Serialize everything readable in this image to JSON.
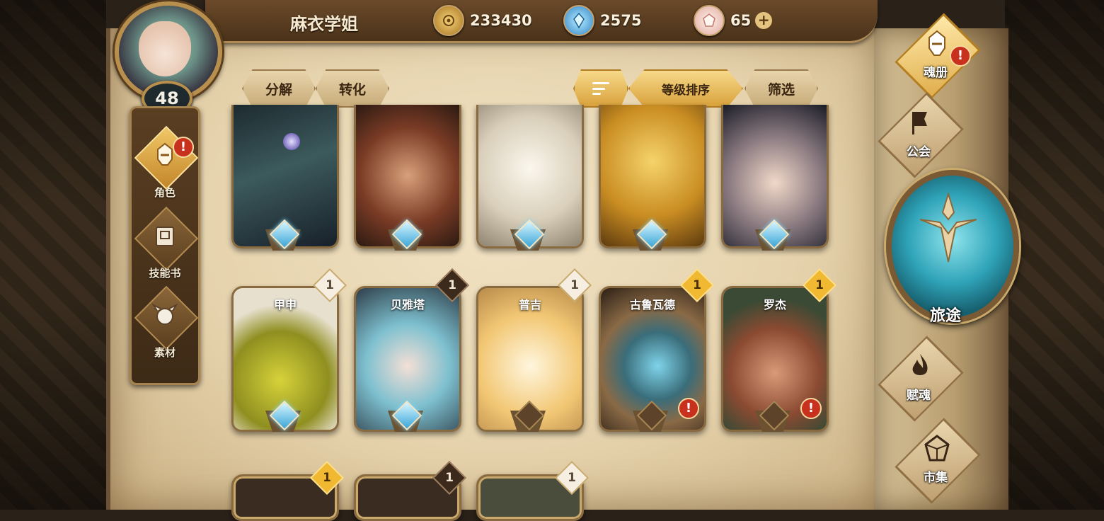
{
  "player": {
    "name": "麻衣学姐",
    "level": "48"
  },
  "currencies": [
    {
      "icon": "gold-coin-icon",
      "value": "233430"
    },
    {
      "icon": "blue-gem-icon",
      "value": "2575"
    },
    {
      "icon": "pink-crystal-icon",
      "value": "65"
    }
  ],
  "add_label": "+",
  "left_nav": [
    {
      "label": "角色",
      "icon": "helmet-icon",
      "active": true,
      "alert": "!"
    },
    {
      "label": "技能书",
      "icon": "skill-book-icon",
      "active": false
    },
    {
      "label": "素材",
      "icon": "material-icon",
      "active": false
    }
  ],
  "actions": {
    "decompose": "分解",
    "convert": "转化",
    "sort_level": "等级排序",
    "filter": "筛选"
  },
  "cards_row1": [
    {
      "name": "",
      "art": "dark-armored-beast"
    },
    {
      "name": "",
      "art": "mustached-pirate"
    },
    {
      "name": "",
      "art": "white-lion"
    },
    {
      "name": "",
      "art": "golden-serpent"
    },
    {
      "name": "",
      "art": "dark-haired-swordsman"
    }
  ],
  "cards_row2": [
    {
      "name": "甲申",
      "rank": "1",
      "rank_style": "white",
      "gem": "blue"
    },
    {
      "name": "贝雅塔",
      "rank": "1",
      "rank_style": "dark",
      "gem": "blue"
    },
    {
      "name": "普吉",
      "rank": "1",
      "rank_style": "white",
      "gem": "none"
    },
    {
      "name": "古鲁瓦德",
      "rank": "1",
      "rank_style": "gold",
      "gem": "none",
      "alert": "!"
    },
    {
      "name": "罗杰",
      "rank": "1",
      "rank_style": "gold",
      "gem": "none",
      "alert": "!"
    }
  ],
  "cards_row3": [
    {
      "rank": "1",
      "rank_style": "gold"
    },
    {
      "rank": "1",
      "rank_style": "dark"
    },
    {
      "rank": "1",
      "rank_style": "white"
    }
  ],
  "right_nav": [
    {
      "label": "魂册",
      "icon": "soul-helmet-icon",
      "active": true,
      "alert": "!"
    },
    {
      "label": "公会",
      "icon": "guild-banner-icon",
      "active": false
    },
    {
      "label": "旅途",
      "icon": "journey-emblem-icon"
    },
    {
      "label": "赋魂",
      "icon": "soul-flame-icon",
      "active": false
    },
    {
      "label": "市集",
      "icon": "market-crystal-icon",
      "active": false
    }
  ],
  "colors": {
    "accent_gold": "#e0ae4d",
    "alert_red": "#c9311f",
    "gem_blue": "#3aa6d8"
  }
}
